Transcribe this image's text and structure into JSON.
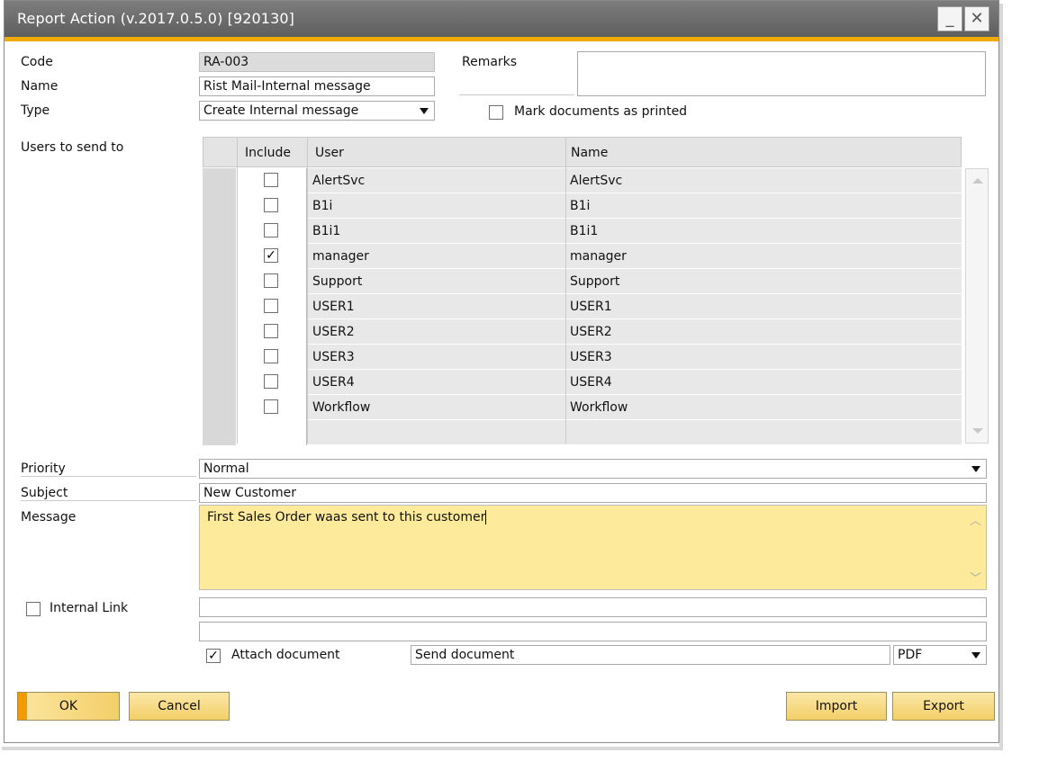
{
  "window": {
    "title": "Report Action (v.2017.0.5.0) [920130]",
    "minimize": "_",
    "close": "✕"
  },
  "form": {
    "code": {
      "label": "Code",
      "value": "RA-003"
    },
    "name": {
      "label": "Name",
      "value": "Rist Mail-Internal message"
    },
    "type": {
      "label": "Type",
      "value": "Create Internal message"
    },
    "remarks": {
      "label": "Remarks",
      "value": ""
    },
    "mark_printed": {
      "label": "Mark documents as printed",
      "checked": false
    }
  },
  "users": {
    "label": "Users to send to",
    "columns": {
      "include": "Include",
      "user": "User",
      "name": "Name"
    },
    "rows": [
      {
        "user": "AlertSvc",
        "name": "AlertSvc",
        "include": false
      },
      {
        "user": "B1i",
        "name": "B1i",
        "include": false
      },
      {
        "user": "B1i1",
        "name": "B1i1",
        "include": false
      },
      {
        "user": "manager",
        "name": "manager",
        "include": true
      },
      {
        "user": "Support",
        "name": "Support",
        "include": false
      },
      {
        "user": "USER1",
        "name": "USER1",
        "include": false
      },
      {
        "user": "USER2",
        "name": "USER2",
        "include": false
      },
      {
        "user": "USER3",
        "name": "USER3",
        "include": false
      },
      {
        "user": "USER4",
        "name": "USER4",
        "include": false
      },
      {
        "user": "Workflow",
        "name": "Workflow",
        "include": false
      }
    ]
  },
  "priority": {
    "label": "Priority",
    "value": "Normal"
  },
  "subject": {
    "label": "Subject",
    "value": "New Customer"
  },
  "message": {
    "label": "Message",
    "value": "First Sales Order waas sent to this customer"
  },
  "internal_link": {
    "label": "Internal Link",
    "checked": false,
    "value1": "",
    "value2": ""
  },
  "attach": {
    "label": "Attach document",
    "checked": true,
    "value": "Send document",
    "format": "PDF"
  },
  "buttons": {
    "ok": "OK",
    "cancel": "Cancel",
    "import": "Import",
    "export": "Export"
  },
  "colors": {
    "accent": "#f0ab00",
    "message_bg": "#fdeb9b",
    "button": "#f2cf68"
  }
}
